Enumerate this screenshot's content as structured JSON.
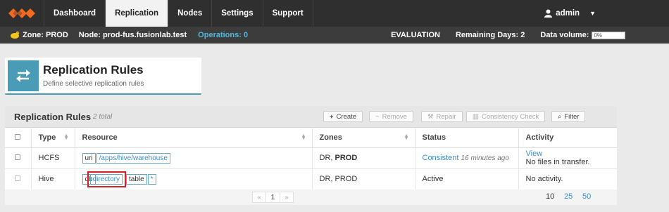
{
  "nav": {
    "tabs": [
      "Dashboard",
      "Replication",
      "Nodes",
      "Settings",
      "Support"
    ],
    "active_tab": "Replication",
    "user": "admin"
  },
  "status": {
    "zone": "Zone: PROD",
    "node": "Node: prod-fus.fusionlab.test",
    "operations": "Operations: 0",
    "license": "EVALUATION",
    "remaining": "Remaining Days: 2",
    "volume_label": "Data volume:",
    "volume_value": "0%",
    "volume_fraction": 0.0
  },
  "header": {
    "title": "Replication Rules",
    "subtitle": "Define selective replication rules"
  },
  "panel": {
    "title": "Replication Rules",
    "count": "2 total",
    "buttons": {
      "create": "Create",
      "remove": "Remove",
      "repair": "Repair",
      "consistency": "Consistency Check",
      "filter": "Filter"
    }
  },
  "table": {
    "columns": [
      "Type",
      "Resource",
      "Zones",
      "Status",
      "Activity"
    ],
    "rows": [
      {
        "type": "HCFS",
        "res_label": "uri",
        "res_value": "/apps/hive/warehouse",
        "zones_a": "DR,",
        "zones_b": "PROD",
        "status": "Consistent",
        "status_ago": "16 minutes ago",
        "activity_link": "View",
        "activity_text": "No files in transfer."
      },
      {
        "type": "Hive",
        "res_db": "db",
        "res_dir": "directory",
        "res_table": "table",
        "res_star": "*",
        "zones": "DR, PROD",
        "status": "Active",
        "activity_text": "No activity."
      }
    ]
  },
  "pager": {
    "prev": "«",
    "page": "1",
    "next": "»",
    "sizes": [
      "10",
      "25",
      "50"
    ]
  },
  "colors": {
    "accent": "#4a9bb5",
    "link": "#3b8fc7",
    "highlight": "#d42020",
    "logo": "#f26b21"
  }
}
